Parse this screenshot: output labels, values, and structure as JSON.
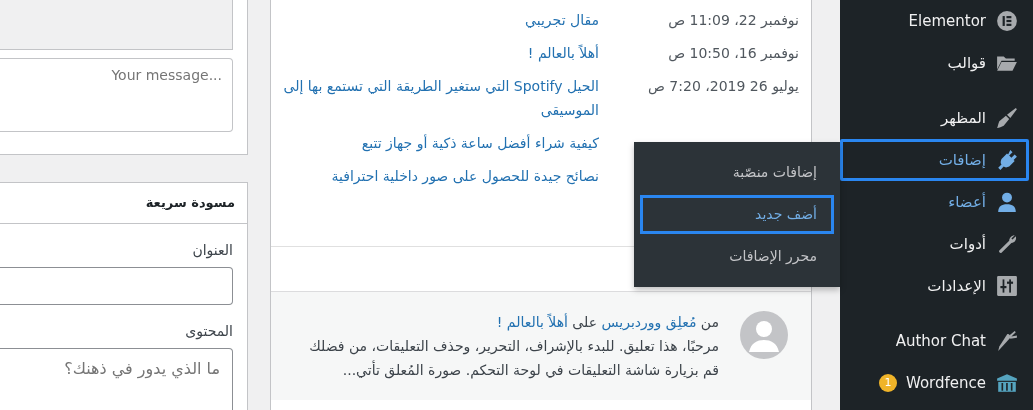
{
  "sidebar": {
    "groups": [
      {
        "items": [
          {
            "label": "Elementor",
            "active": false,
            "focused": false
          },
          {
            "label": "قوالب",
            "active": false,
            "focused": false
          }
        ]
      },
      {
        "items": [
          {
            "label": "المظهر",
            "active": false,
            "focused": false
          },
          {
            "label": "إضافات",
            "active": true,
            "focused": true
          },
          {
            "label": "أعضاء",
            "active": true,
            "focused": false
          },
          {
            "label": "أدوات",
            "active": false,
            "focused": false
          },
          {
            "label": "الإعدادات",
            "active": false,
            "focused": false
          }
        ]
      },
      {
        "items": [
          {
            "label": "Author Chat",
            "active": false,
            "focused": false
          },
          {
            "label": "Wordfence",
            "active": false,
            "focused": false,
            "badge": "1"
          }
        ]
      }
    ]
  },
  "flyout": {
    "items": [
      {
        "label": "إضافات منصّبة",
        "focused": false
      },
      {
        "label": "أضف جديد",
        "focused": true
      },
      {
        "label": "محرر الإضافات",
        "focused": false
      }
    ]
  },
  "activity": {
    "rows": [
      {
        "date": "نوفمبر 22، 11:09 ص",
        "title": "مقال تجريبي"
      },
      {
        "date": "نوفمبر 16، 10:50 ص",
        "title": "أهلاً بالعالم !"
      },
      {
        "date": "يوليو 26 2019، 7:20 ص",
        "title": "الحيل Spotify التي ستغير الطريقة التي تستمع بها إلى الموسيقى"
      },
      {
        "title": "كيفية شراء أفضل ساعة ذكية أو جهاز تتبع"
      },
      {
        "title": "نصائح جيدة للحصول على صور داخلية احترافية"
      }
    ]
  },
  "comment": {
    "prefix": "من",
    "author": "مُعلِق ووردبريس",
    "connector": "على",
    "post": "أهلاً بالعالم !",
    "excerpt": "مرحبًا، هذا تعليق. للبدء بالإشراف، التحرير، وحذف التعليقات، من فضلك قم بزيارة شاشة التعليقات في لوحة التحكم. صورة المُعلق تأتي..."
  },
  "chat": {
    "message_placeholder": "Your message..."
  },
  "quick_draft": {
    "heading": "مسودة سريعة",
    "title_label": "العنوان",
    "content_label": "المحتوى",
    "content_placeholder": "ما الذي يدور في ذهنك؟"
  }
}
